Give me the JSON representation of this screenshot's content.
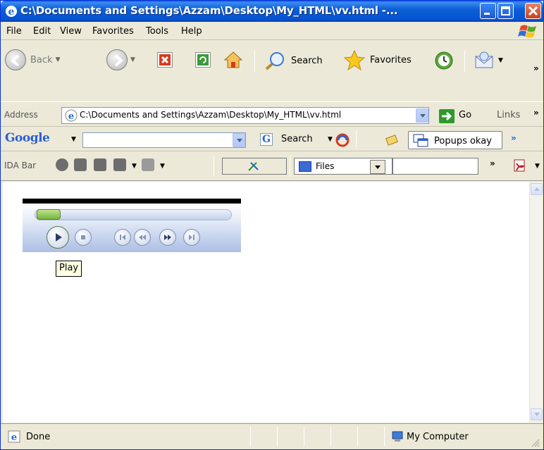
{
  "window": {
    "title": "C:\\Documents and Settings\\Azzam\\Desktop\\My_HTML\\vv.html -..."
  },
  "menu": {
    "items": [
      "File",
      "Edit",
      "View",
      "Favorites",
      "Tools",
      "Help"
    ]
  },
  "toolbar": {
    "back_label": "Back",
    "search_label": "Search",
    "favorites_label": "Favorites"
  },
  "address_bar": {
    "label": "Address",
    "value": "C:\\Documents and Settings\\Azzam\\Desktop\\My_HTML\\vv.html",
    "go_label": "Go",
    "links_label": "Links"
  },
  "google_bar": {
    "logo_text": "Google",
    "search_value": "",
    "search_label": "Search",
    "popups_label": "Popups okay"
  },
  "ida_bar": {
    "label": "IDA Bar",
    "files_label": "Files",
    "input_value": ""
  },
  "media_player": {
    "seek_fraction": 0.0,
    "tooltip": "Play"
  },
  "status_bar": {
    "status_text": "Done",
    "zone_text": "My Computer"
  },
  "colors": {
    "titlebar": "#0554d1",
    "chrome": "#ece9d8",
    "tooltip_bg": "#ffffe1"
  }
}
